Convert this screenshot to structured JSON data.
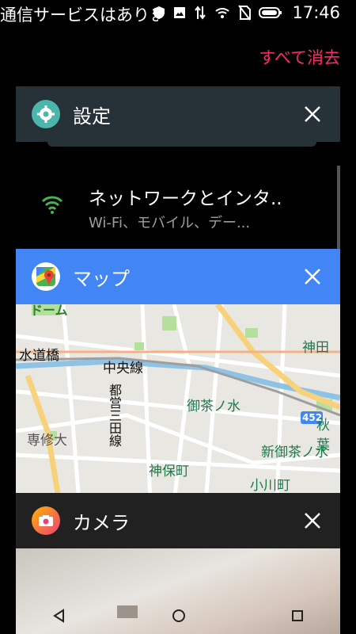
{
  "status_bar": {
    "notification_text": "通信サービスはありません",
    "time": "17:46"
  },
  "clear_all_label": "すべて消去",
  "cards": [
    {
      "title": "設定",
      "header_color": "#263238",
      "icon": "gear-icon",
      "preview_item_title": "ネットワークとインタ..",
      "preview_item_subtitle": "Wi-Fi、モバイル、デー..."
    },
    {
      "title": "マップ",
      "header_color": "#4285f4",
      "icon": "google-maps-icon",
      "map_labels": {
        "suidobashi": "水道橋",
        "chuo_line": "中央線",
        "mita_line": "都営三田線",
        "ochanomizu": "御茶ノ水",
        "senshu": "専修大",
        "jimbocho": "神保町",
        "shin_ochanomizu": "新御茶ノ水",
        "ogawamachi": "小川町",
        "kanda": "神田",
        "akiba": "秋葉",
        "route": "452",
        "top_left": "ドーム"
      }
    },
    {
      "title": "カメラ",
      "header_color": "#212121",
      "icon": "camera-icon"
    }
  ]
}
